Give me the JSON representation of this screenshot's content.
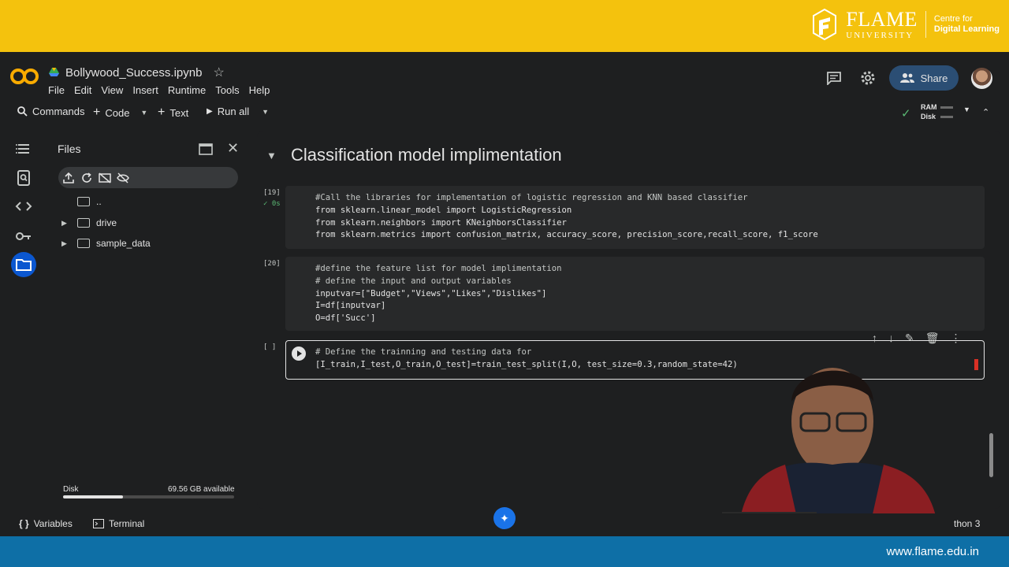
{
  "banner": {
    "brand": "FLAME",
    "brand_sub": "UNIVERSITY",
    "centre_line1": "Centre for",
    "centre_line2": "Digital Learning",
    "url": "www.flame.edu.in"
  },
  "header": {
    "logo_text": "CO",
    "title": "Bollywood_Success.ipynb",
    "menu": [
      "File",
      "Edit",
      "View",
      "Insert",
      "Runtime",
      "Tools",
      "Help"
    ],
    "share_label": "Share"
  },
  "toolbar": {
    "commands_label": "Commands",
    "code_label": "Code",
    "text_label": "Text",
    "run_all_label": "Run all",
    "ram_label": "RAM",
    "disk_label": "Disk"
  },
  "files_panel": {
    "title": "Files",
    "items": [
      {
        "name": "..",
        "expandable": false
      },
      {
        "name": "drive",
        "expandable": true
      },
      {
        "name": "sample_data",
        "expandable": true
      }
    ],
    "disk_label": "Disk",
    "disk_available": "69.56 GB available",
    "disk_used_fraction": 0.35
  },
  "notebook": {
    "section_title": "Classification model implimentation",
    "cells": [
      {
        "count": "[19]",
        "status": "0s",
        "lines": [
          "#Call the libraries for implementation of logistic regression and KNN based classifier",
          "from sklearn.linear_model import LogisticRegression",
          "from sklearn.neighbors import KNeighborsClassifier",
          "from sklearn.metrics import confusion_matrix, accuracy_score, precision_score,recall_score, f1_score"
        ]
      },
      {
        "count": "[20]",
        "lines": [
          "#define the feature list for model implimentation",
          "# define the input and output variables",
          "inputvar=[\"Budget\",\"Views\",\"Likes\",\"Dislikes\"]",
          "I=df[inputvar]",
          "O=df['Succ']"
        ]
      },
      {
        "count": "[ ]",
        "lines": [
          "# Define the trainning and testing data for ",
          "[I_train,I_test,O_train,O_test]=train_test_split(I,O, test_size=0.3,random_state=42)"
        ]
      }
    ]
  },
  "statusbar": {
    "variables_label": "Variables",
    "terminal_label": "Terminal",
    "runtime_label": "thon 3"
  },
  "colors": {
    "banner_yellow": "#f4c20d",
    "banner_blue": "#0e6fa6",
    "background": "#1e1f20",
    "accent_blue": "#0b57d0",
    "share_bg": "#2b4e74",
    "ok_green": "#5bb974",
    "keyword": "#d7a3f1",
    "string": "#f28b82"
  },
  "icons": [
    "menu-icon",
    "search-icon",
    "code-icon",
    "key-icon",
    "folder-icon",
    "comment-icon",
    "gear-icon",
    "share-icon",
    "upload-icon",
    "refresh-icon",
    "drive-off-icon",
    "eye-off-icon",
    "close-icon",
    "run-icon",
    "arrow-up-icon",
    "arrow-down-icon",
    "edit-icon",
    "delete-icon",
    "more-icon",
    "gemini-icon"
  ]
}
